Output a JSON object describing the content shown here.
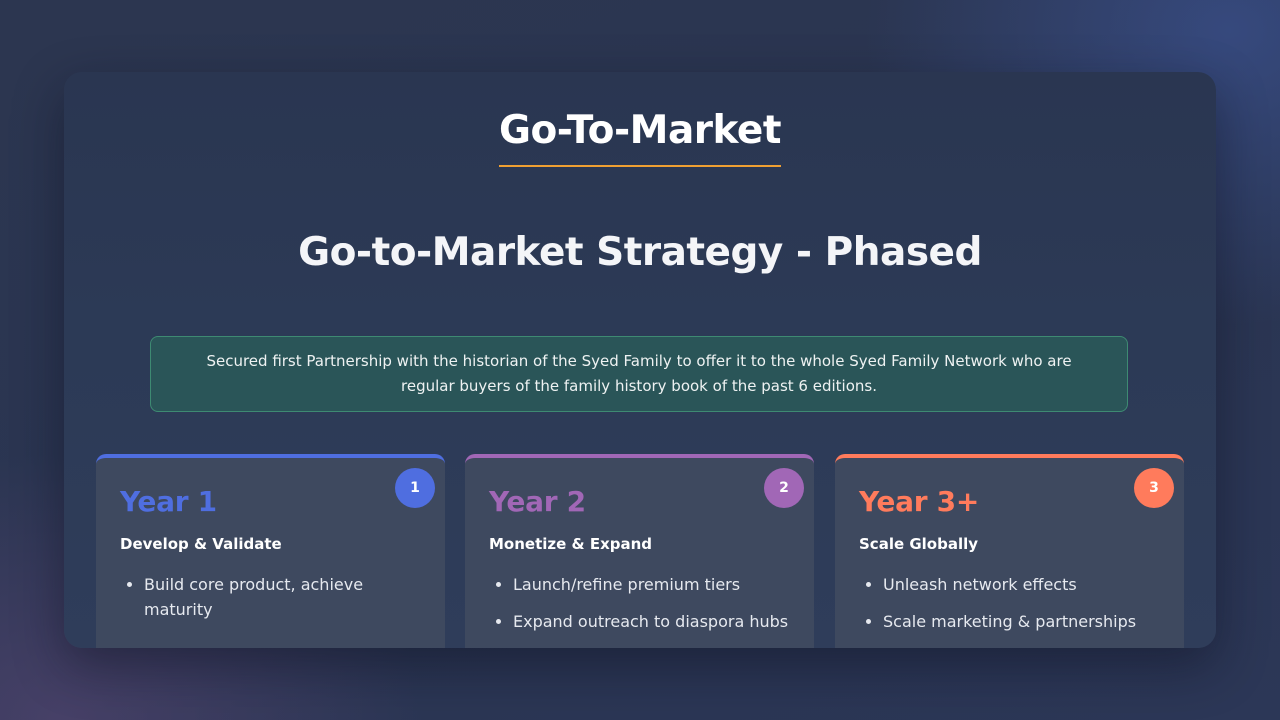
{
  "slide": {
    "section_title": "Go-To-Market",
    "headline": "Go-to-Market Strategy - Phased",
    "callout_text": "Secured first Partnership with the historian of the Syed Family to offer it to the whole Syed Family Network who are regular buyers of the family history book of the past 6 editions."
  },
  "colors": {
    "underline": "#f0a032",
    "phase1": "#4f6ee0",
    "phase2": "#a167b6",
    "phase3": "#ff7b5c",
    "callout_bg": "#2a5558",
    "card_bg": "#3e495f"
  },
  "phases": [
    {
      "badge": "1",
      "year": "Year 1",
      "subtitle": "Develop & Validate",
      "bullets": [
        "Build core product, achieve maturity"
      ]
    },
    {
      "badge": "2",
      "year": "Year 2",
      "subtitle": "Monetize & Expand",
      "bullets": [
        "Launch/refine premium tiers",
        "Expand outreach to diaspora hubs"
      ]
    },
    {
      "badge": "3",
      "year": "Year 3+",
      "subtitle": "Scale Globally",
      "bullets": [
        "Unleash network effects",
        "Scale marketing & partnerships"
      ]
    }
  ]
}
